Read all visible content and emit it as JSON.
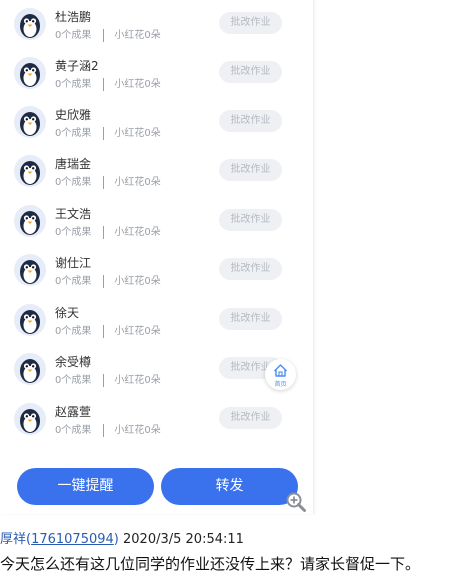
{
  "students": [
    {
      "name": "杜浩鹏",
      "achievements": "0个成果",
      "flowers": "小红花0朵",
      "action": "批改作业"
    },
    {
      "name": "黄子涵2",
      "achievements": "0个成果",
      "flowers": "小红花0朵",
      "action": "批改作业"
    },
    {
      "name": "史欣雅",
      "achievements": "0个成果",
      "flowers": "小红花0朵",
      "action": "批改作业"
    },
    {
      "name": "唐瑞金",
      "achievements": "0个成果",
      "flowers": "小红花0朵",
      "action": "批改作业"
    },
    {
      "name": "王文浩",
      "achievements": "0个成果",
      "flowers": "小红花0朵",
      "action": "批改作业"
    },
    {
      "name": "谢仕江",
      "achievements": "0个成果",
      "flowers": "小红花0朵",
      "action": "批改作业"
    },
    {
      "name": "徐天",
      "achievements": "0个成果",
      "flowers": "小红花0朵",
      "action": "批改作业"
    },
    {
      "name": "余受樽",
      "achievements": "0个成果",
      "flowers": "小红花0朵",
      "action": "批改作业"
    },
    {
      "name": "赵露萱",
      "achievements": "0个成果",
      "flowers": "小红花0朵",
      "action": "批改作业"
    }
  ],
  "home_float": {
    "label": "首页",
    "icon": "home-icon"
  },
  "actions": {
    "remind_all": "一键提醒",
    "forward": "转发"
  },
  "zoom_icon": "zoom-in-icon",
  "comment": {
    "author": "厚祥(",
    "uid": "1761075094",
    "author_close": ")",
    "timestamp": "2020/3/5 20:54:11",
    "text": "今天怎么还有这几位同学的作业还没传上来？请家长督促一下。"
  },
  "colors": {
    "accent": "#3a72ee",
    "link": "#2a5db0",
    "disabled_btn": "#eef0f4"
  }
}
